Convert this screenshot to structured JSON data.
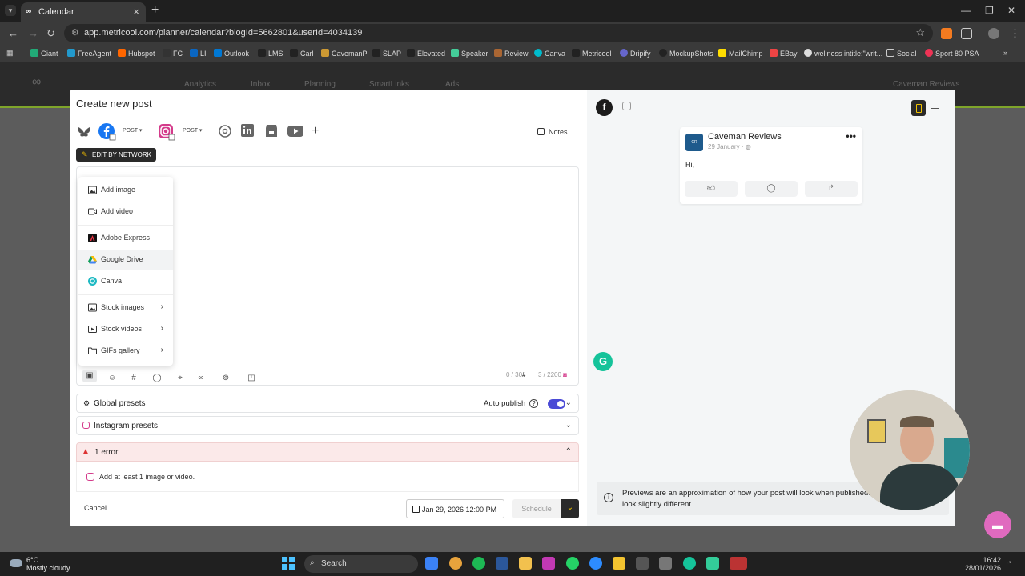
{
  "browser": {
    "tab_title": "Calendar",
    "url": "app.metricool.com/planner/calendar?blogId=5662801&userId=4034139",
    "bookmarks": [
      "Giant",
      "FreeAgent",
      "Hubspot",
      "FC",
      "LI",
      "Outlook",
      "LMS",
      "Carl",
      "CavemanP",
      "SLAP",
      "Elevated",
      "Speaker",
      "Review",
      "Canva",
      "Metricool",
      "Dripify",
      "MockupShots",
      "MailChimp",
      "EBay",
      "wellness intitle:\"writ...",
      "Social",
      "Sport 80 PSA"
    ]
  },
  "appnav": {
    "items": [
      "Analytics",
      "Inbox",
      "Planning",
      "SmartLinks",
      "Ads"
    ],
    "account": "Caveman Reviews"
  },
  "modal": {
    "title": "Create new post",
    "networks": {
      "fb_type": "POST",
      "ig_type": "POST"
    },
    "notes_label": "Notes",
    "edit_by_network": "EDIT BY NETWORK",
    "media_menu": {
      "add_image": "Add image",
      "add_video": "Add video",
      "adobe_express": "Adobe Express",
      "google_drive": "Google Drive",
      "canva": "Canva",
      "stock_images": "Stock images",
      "stock_videos": "Stock videos",
      "gifs_gallery": "GIFs gallery"
    },
    "hashtag_counter": "0 / 30",
    "char_counter": "3 / 2200",
    "global_presets": "Global presets",
    "auto_publish": "Auto publish",
    "auto_publish_on": true,
    "instagram_presets": "Instagram presets",
    "error_title": "1 error",
    "error_message": "Add at least 1 image or video.",
    "cancel": "Cancel",
    "date": "Jan 29, 2026 12:00 PM",
    "schedule": "Schedule"
  },
  "preview": {
    "page_name": "Caveman Reviews",
    "date": "29 January",
    "text": "Hi,",
    "notice": "Previews are an approximation of how your post will look when published. The final post may look slightly different."
  },
  "taskbar": {
    "temp": "6°C",
    "weather": "Mostly cloudy",
    "search": "Search",
    "time": "16:42",
    "date": "28/01/2026"
  },
  "colors": {
    "accent_yellow": "#f0c200",
    "toggle_blue": "#4a4ad6",
    "error_red": "#d33333",
    "instagram_pink": "#d43b8b"
  }
}
